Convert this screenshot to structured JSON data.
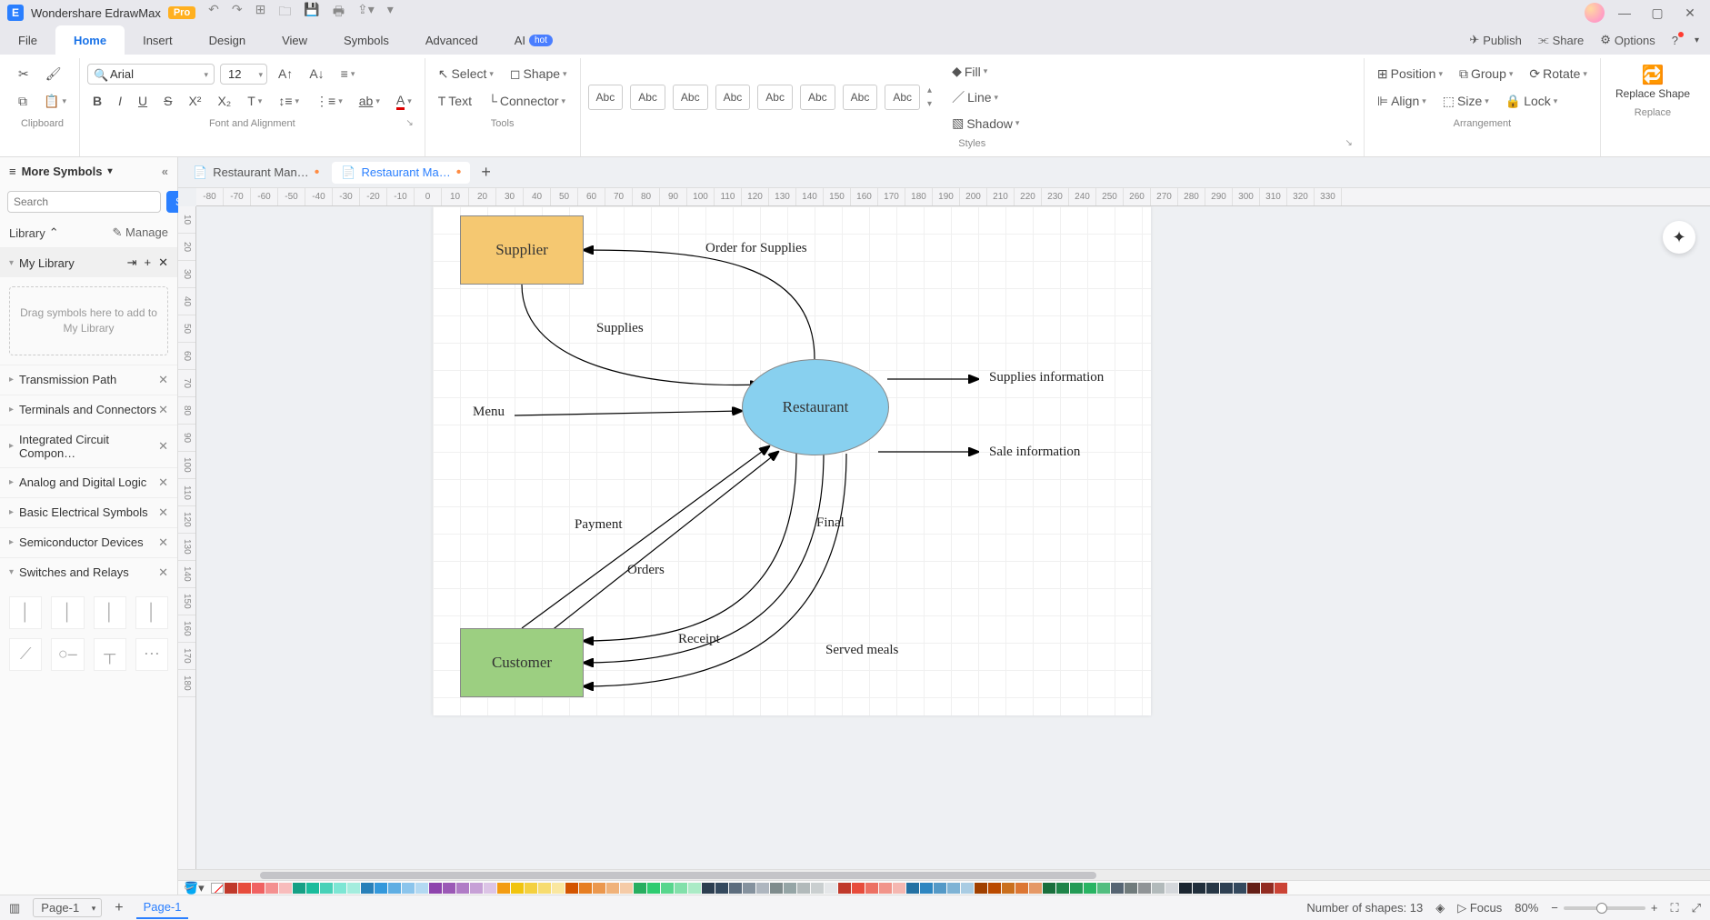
{
  "app": {
    "title": "Wondershare EdrawMax",
    "badge": "Pro"
  },
  "menus": {
    "file": "File",
    "home": "Home",
    "insert": "Insert",
    "design": "Design",
    "view": "View",
    "symbols": "Symbols",
    "advanced": "Advanced",
    "ai": "AI",
    "hot": "hot"
  },
  "topright": {
    "publish": "Publish",
    "share": "Share",
    "options": "Options"
  },
  "ribbon": {
    "clipboard": "Clipboard",
    "font": "Arial",
    "size": "12",
    "font_group": "Font and Alignment",
    "select": "Select",
    "shape": "Shape",
    "text": "Text",
    "connector": "Connector",
    "tools_group": "Tools",
    "style_label": "Abc",
    "styles_group": "Styles",
    "fill": "Fill",
    "line": "Line",
    "shadow": "Shadow",
    "position": "Position",
    "group": "Group",
    "rotate": "Rotate",
    "align": "Align",
    "sizebtn": "Size",
    "lock": "Lock",
    "arrangement": "Arrangement",
    "replace_shape": "Replace Shape",
    "replace": "Replace"
  },
  "sidebar": {
    "title": "More Symbols",
    "search_ph": "Search",
    "search_btn": "Search",
    "library": "Library",
    "manage": "Manage",
    "mylib": "My Library",
    "dropzone": "Drag symbols here to add to My Library",
    "cats": [
      "Transmission Path",
      "Terminals and Connectors",
      "Integrated Circuit Compon…",
      "Analog and Digital Logic",
      "Basic Electrical Symbols",
      "Semiconductor Devices",
      "Switches and Relays"
    ]
  },
  "doctabs": {
    "t1": "Restaurant Man…",
    "t2": "Restaurant Ma…"
  },
  "ruler_h": [
    "-80",
    "-70",
    "-60",
    "-50",
    "-40",
    "-30",
    "-20",
    "-10",
    "0",
    "10",
    "20",
    "30",
    "40",
    "50",
    "60",
    "70",
    "80",
    "90",
    "100",
    "110",
    "120",
    "130",
    "140",
    "150",
    "160",
    "170",
    "180",
    "190",
    "200",
    "210",
    "220",
    "230",
    "240",
    "250",
    "260",
    "270",
    "280",
    "290",
    "300",
    "310",
    "320",
    "330"
  ],
  "ruler_v": [
    "10",
    "20",
    "30",
    "40",
    "50",
    "60",
    "70",
    "80",
    "90",
    "100",
    "110",
    "120",
    "130",
    "140",
    "150",
    "160",
    "170",
    "180"
  ],
  "diagram": {
    "supplier": "Supplier",
    "customer": "Customer",
    "restaurant": "Restaurant",
    "order_supplies": "Order for Supplies",
    "supplies": "Supplies",
    "menu": "Menu",
    "supplies_info": "Supplies information",
    "sale_info": "Sale information",
    "payment": "Payment",
    "final": "Final",
    "orders": "Orders",
    "receipt": "Receipt",
    "served": "Served meals"
  },
  "colors": [
    "#c0392b",
    "#e74c3c",
    "#f06262",
    "#f49090",
    "#f8bcbc",
    "#16a085",
    "#1abc9c",
    "#48d1b8",
    "#7de6d4",
    "#a4edde",
    "#2980b9",
    "#3498db",
    "#5faee3",
    "#8cc5ec",
    "#b3d9f2",
    "#8e44ad",
    "#9b59b6",
    "#b07cc6",
    "#c6a0d6",
    "#dcc4e6",
    "#f39c12",
    "#f1c40f",
    "#f4d03f",
    "#f7dc6f",
    "#fae7a0",
    "#d35400",
    "#e67e22",
    "#eb984e",
    "#f0b27a",
    "#f5cba7",
    "#27ae60",
    "#2ecc71",
    "#58d68d",
    "#82e0aa",
    "#abebc6",
    "#2c3e50",
    "#34495e",
    "#5d6d7e",
    "#85929e",
    "#aeb6bf",
    "#7f8c8d",
    "#95a5a6",
    "#b2babb",
    "#cacfd0",
    "#e5e7e9",
    "#c0392b",
    "#e74c3c",
    "#ec7063",
    "#f1948a",
    "#f5b7b1",
    "#2471a3",
    "#2e86c1",
    "#5499c7",
    "#7fb3d5",
    "#a9cce3",
    "#a04000",
    "#ba4a00",
    "#ca6f1e",
    "#dc7633",
    "#e59866",
    "#196f3d",
    "#1e8449",
    "#239b56",
    "#28b463",
    "#52be80",
    "#566573",
    "#707b7c",
    "#909497",
    "#b2babb",
    "#d5d8dc",
    "#1b2631",
    "#212f3c",
    "#273746",
    "#2e4053",
    "#34495e",
    "#641e16",
    "#922b21",
    "#cb4335"
  ],
  "status": {
    "page_sel": "Page-1",
    "addpage": "+",
    "page_tab": "Page-1",
    "shapes": "Number of shapes: 13",
    "focus": "Focus",
    "zoom": "80%"
  }
}
